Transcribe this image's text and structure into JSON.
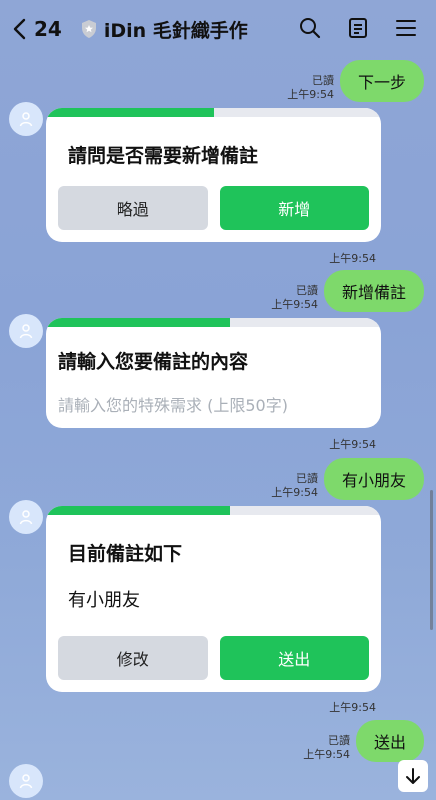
{
  "header": {
    "back_count": "24",
    "title": "iDin 毛針織手作"
  },
  "messages": {
    "out1": {
      "read": "已讀",
      "time": "上午9:54",
      "text": "下一步"
    },
    "card1": {
      "title": "請問是否需要新增備註",
      "progress": 0.5,
      "btn_left": "略過",
      "btn_right": "新增",
      "time": "上午9:54"
    },
    "out2": {
      "read": "已讀",
      "time": "上午9:54",
      "text": "新增備註"
    },
    "card2": {
      "title": "請輸入您要備註的內容",
      "progress": 0.55,
      "placeholder": "請輸入您的特殊需求 (上限50字)",
      "time": "上午9:54"
    },
    "out3": {
      "read": "已讀",
      "time": "上午9:54",
      "text": "有小朋友"
    },
    "card3": {
      "title": "目前備註如下",
      "progress": 0.55,
      "note": "有小朋友",
      "btn_left": "修改",
      "btn_right": "送出",
      "time": "上午9:54"
    },
    "out4": {
      "read": "已讀",
      "time": "上午9:54",
      "text": "送出"
    }
  },
  "colors": {
    "accent_green": "#1fc35a",
    "bubble_green": "#7ed96b",
    "background": "#8aa3d6"
  }
}
